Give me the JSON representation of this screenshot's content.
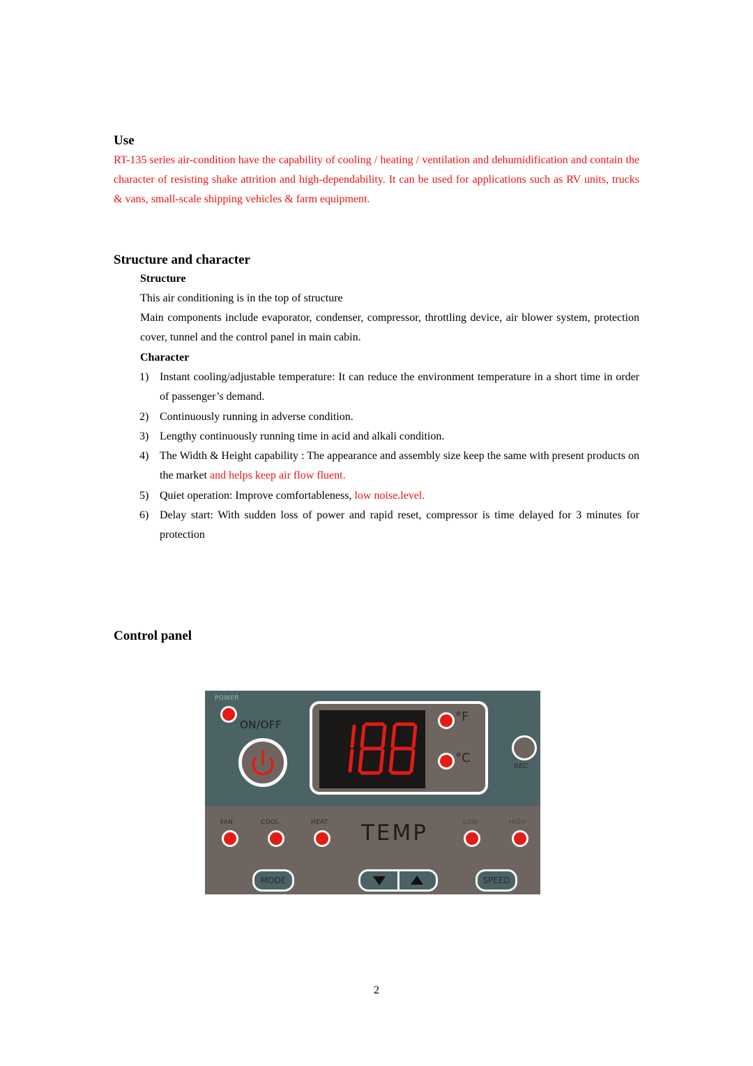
{
  "use_section": {
    "heading": "Use",
    "paragraph": "RT-135 series air-condition have the capability of cooling / heating / ventilation and dehumidification and contain the character of resisting shake attrition and high-dependability. It can be used for applications such as RV units, trucks & vans, small-scale shipping vehicles & farm equipment."
  },
  "structure_section": {
    "heading": "Structure and character",
    "structure": {
      "subheading": "Structure",
      "line1": "This air conditioning is in the top of structure",
      "line2": "Main components include evaporator, condenser, compressor, throttling device, air blower system, protection cover, tunnel and the control panel in main cabin."
    },
    "character": {
      "subheading": "Character",
      "items": [
        {
          "num": "1)",
          "text": "Instant cooling/adjustable temperature: It can reduce the environment temperature in a short time in order of passenger’s demand.",
          "red": ""
        },
        {
          "num": "2)",
          "text": "Continuously running in adverse condition.",
          "red": ""
        },
        {
          "num": "3)",
          "text": "Lengthy continuously running time in acid and alkali condition.",
          "red": ""
        },
        {
          "num": "4)",
          "text": "The Width & Height capability : The appearance and assembly size keep the same with present products on the market ",
          "red": "and helps keep air flow fluent."
        },
        {
          "num": "5)",
          "text": "Quiet operation: Improve comfortableness, ",
          "red": "low noise.level."
        },
        {
          "num": "6)",
          "text": "Delay start: With sudden loss of power and rapid reset, compressor is time delayed for 3 minutes for protection",
          "red": ""
        }
      ]
    }
  },
  "control_panel_section": {
    "heading": "Control panel",
    "panel": {
      "power_label": "POWER",
      "onoff_label": "ON/OFF",
      "display_value": "188",
      "unit_f": "°F",
      "unit_c": "°C",
      "rec_label": "REC",
      "mode_indicators": [
        "FAN",
        "COOL",
        "HEAT"
      ],
      "speed_indicators": [
        "LOW",
        "HIGH"
      ],
      "temp_label": "TEMP",
      "mode_button": "MODE",
      "speed_button": "SPEED",
      "led_color": "#e51c14",
      "top_color": "#4c6366",
      "bottom_color": "#6e6560",
      "segment_color": "#e21b16"
    }
  },
  "footer": {
    "page_number": "2"
  }
}
